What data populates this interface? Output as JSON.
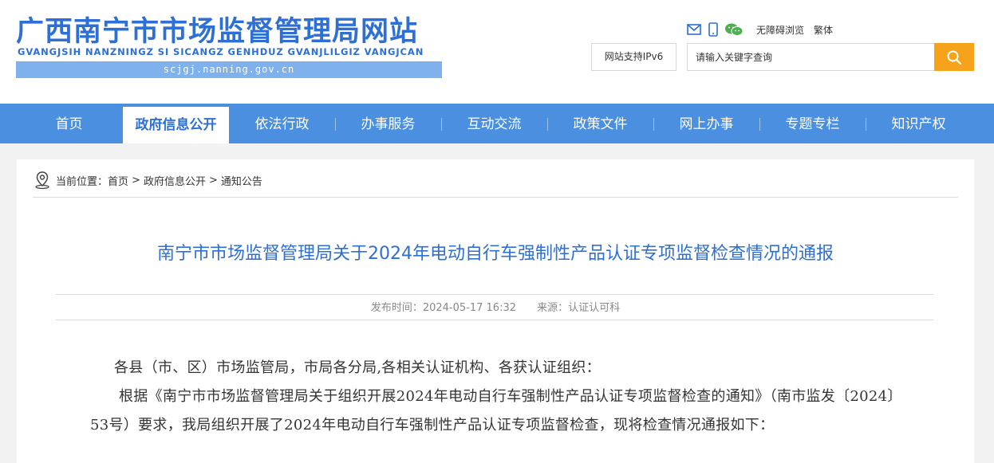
{
  "site": {
    "title": "广西南宁市市场监督管理局网站",
    "pinyin": "GVANGJSIH NANZNINGZ SI SICANGZ GENHDUZ GVANJLILGIZ VANGJCAN",
    "domain": "scjgj.nanning.gov.cn"
  },
  "tools": {
    "icons": [
      "mail-icon",
      "mobile-icon",
      "wechat-icon"
    ],
    "accessibility": "无障碍浏览",
    "traditional": "繁体"
  },
  "ipv6_label": "网站支持IPv6",
  "search": {
    "placeholder": "请输入关键字查询",
    "button_icon": "search-icon"
  },
  "nav": [
    {
      "label": "首页"
    },
    {
      "label": "政府信息公开",
      "active": true
    },
    {
      "label": "依法行政"
    },
    {
      "label": "办事服务"
    },
    {
      "label": "互动交流"
    },
    {
      "label": "政策文件"
    },
    {
      "label": "网上办事"
    },
    {
      "label": "专题专栏"
    },
    {
      "label": "知识产权"
    }
  ],
  "breadcrumb": {
    "prefix": "当前位置：",
    "items": [
      "首页",
      "政府信息公开",
      "通知公告"
    ],
    "separator": ">"
  },
  "article": {
    "title": "南宁市市场监督管理局关于2024年电动自行车强制性产品认证专项监督检查情况的通报",
    "publish_time": "发布时间：2024-05-17 16:32",
    "source": "来源：认证认可科",
    "paragraphs": [
      "各县（市、区）市场监管局，市局各分局,各相关认证机构、各获认证组织：",
      "根据《南宁市市场监督管理局关于组织开展2024年电动自行车强制性产品认证专项监督检查的通知》（南市监发〔2024〕53号）要求，我局组织开展了2024年电动自行车强制性产品认证专项监督检查，现将检查情况通报如下："
    ]
  },
  "colors": {
    "brand_blue": "#2d6fd4",
    "nav_blue": "#4a8fe0",
    "search_orange": "#f7a21b"
  }
}
